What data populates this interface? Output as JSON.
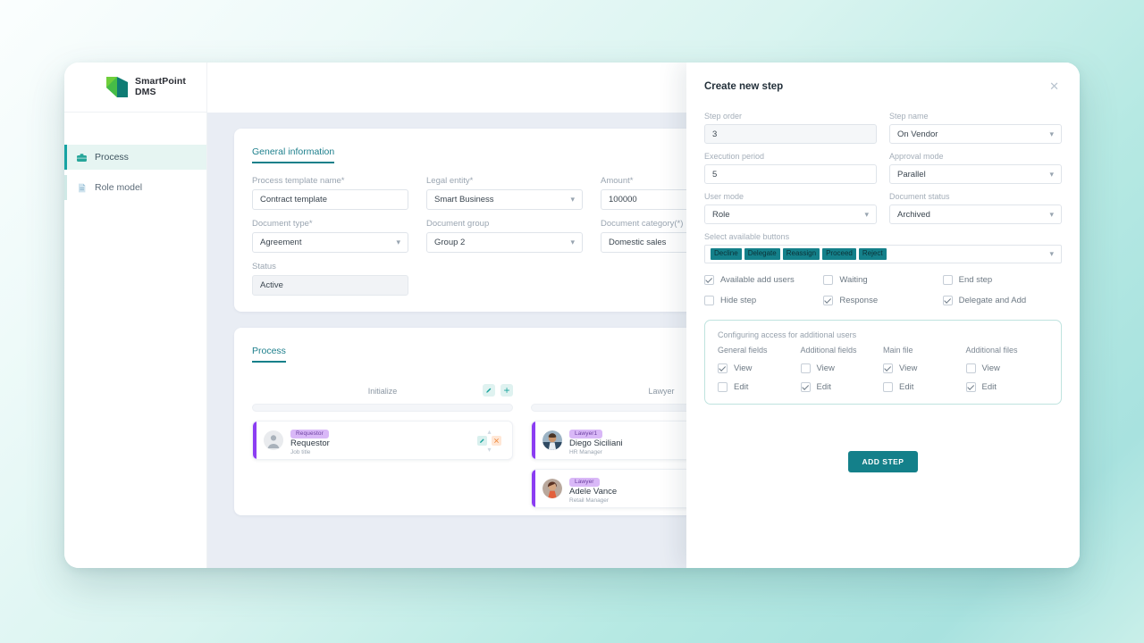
{
  "app": {
    "logo": {
      "line1": "SmartPoint",
      "line2": "DMS",
      "icon": "smartpoint-logo"
    }
  },
  "sidebar": {
    "items": [
      {
        "label": "Process",
        "icon": "briefcase-icon",
        "active": true
      },
      {
        "label": "Role model",
        "icon": "document-icon",
        "active": false
      }
    ]
  },
  "general": {
    "tab_label": "General information",
    "fields": [
      {
        "label": "Process template name*",
        "value": "Contract template",
        "type": "text"
      },
      {
        "label": "Legal entity*",
        "value": "Smart Business",
        "type": "select"
      },
      {
        "label": "Amount*",
        "value": "100000",
        "type": "text"
      },
      {
        "label": "Document type*",
        "value": "Agreement",
        "type": "select"
      },
      {
        "label": "Document group",
        "value": "Group 2",
        "type": "select"
      },
      {
        "label": "Document category(*)",
        "value": "Domestic sales",
        "type": "text"
      }
    ],
    "status": {
      "label": "Status",
      "value": "Active"
    }
  },
  "process": {
    "tab_label": "Process",
    "columns": [
      {
        "title": "Initialize",
        "edit_icon": "pencil-icon",
        "add_icon": "plus-icon",
        "cards": [
          {
            "badge": "Requestor",
            "name": "Requestor",
            "subtitle": "Job title",
            "avatar": "generic-user-avatar"
          }
        ]
      },
      {
        "title": "Lawyer",
        "cards": [
          {
            "badge": "Lawyer1",
            "name": "Diego Siciliani",
            "subtitle": "HR Manager",
            "avatar": "photo-diego"
          },
          {
            "badge": "Lawyer",
            "name": "Adele Vance",
            "subtitle": "Retail Manager",
            "avatar": "photo-adele"
          }
        ]
      }
    ],
    "card_tools": {
      "up": "chevron-up-icon",
      "edit": "pencil-icon",
      "delete": "close-icon",
      "down": "chevron-down-icon"
    }
  },
  "drawer": {
    "title": "Create new step",
    "close_icon": "close-icon",
    "fields": [
      {
        "label": "Step order",
        "value": "3",
        "type": "filled"
      },
      {
        "label": "Step name",
        "value": "On Vendor",
        "type": "select"
      },
      {
        "label": "Execution period",
        "value": "5",
        "type": "text"
      },
      {
        "label": "Approval mode",
        "value": "Parallel",
        "type": "select"
      },
      {
        "label": "User mode",
        "value": "Role",
        "type": "select"
      },
      {
        "label": "Document status",
        "value": "Archived",
        "type": "select"
      }
    ],
    "buttons_field": {
      "label": "Select available buttons",
      "chips": [
        "Decline",
        "Delegate",
        "Reassign",
        "Proceed",
        "Reject"
      ]
    },
    "options": [
      {
        "label": "Available add users",
        "checked": true
      },
      {
        "label": "Waiting",
        "checked": false
      },
      {
        "label": "End step",
        "checked": false
      },
      {
        "label": "Hide step",
        "checked": false
      },
      {
        "label": "Response",
        "checked": true
      },
      {
        "label": "Delegate and Add",
        "checked": true
      }
    ],
    "access": {
      "title": "Configuring access for additional users",
      "columns": [
        {
          "header": "General fields",
          "view": true,
          "edit": false
        },
        {
          "header": "Additional fields",
          "view": false,
          "edit": true
        },
        {
          "header": "Main file",
          "view": true,
          "edit": false
        },
        {
          "header": "Additional files",
          "view": false,
          "edit": true
        }
      ],
      "view_label": "View",
      "edit_label": "Edit"
    },
    "submit_label": "ADD STEP"
  },
  "colors": {
    "accent_teal": "#14808a",
    "chip_teal": "#14808a",
    "badge_purple": "#d9b8f7",
    "card_accent": "#8b3df2",
    "logo_green": "#6fce3b",
    "logo_dark": "#0f7c74"
  }
}
